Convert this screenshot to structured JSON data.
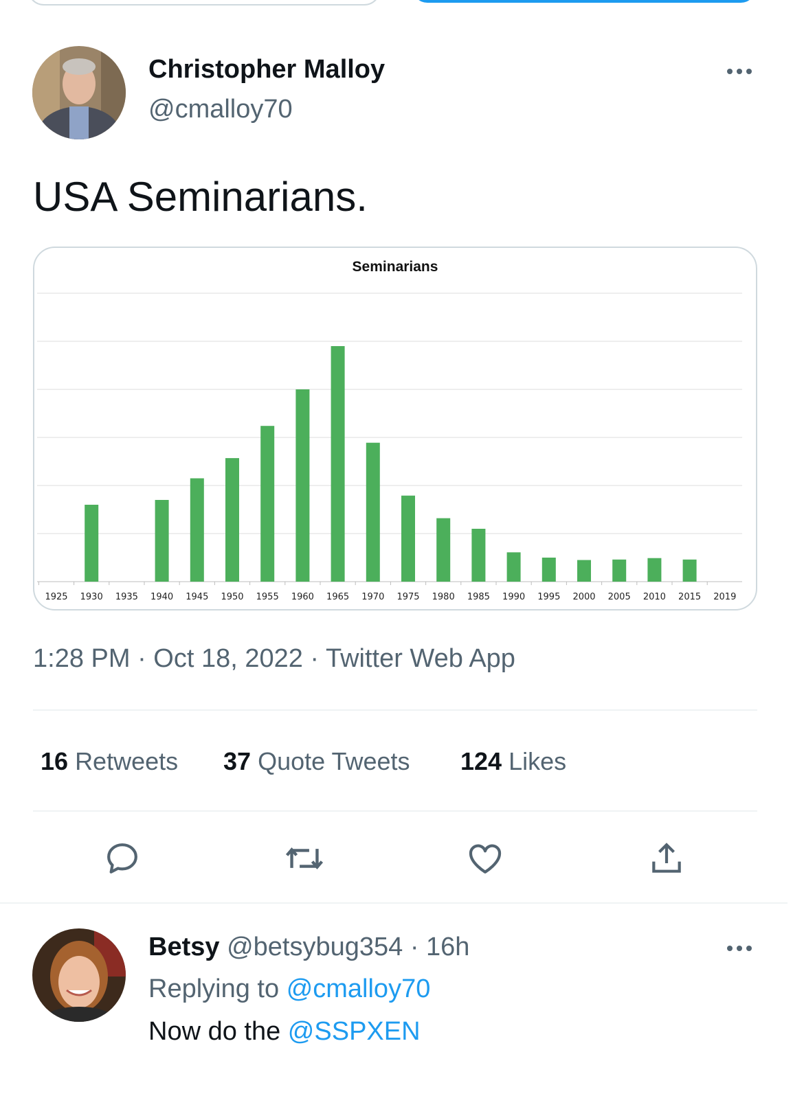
{
  "tweet": {
    "author_name": "Christopher Malloy",
    "author_handle": "@cmalloy70",
    "text": "USA Seminarians.",
    "timestamp": "1:28 PM · Oct 18, 2022 · Twitter Web App",
    "stats": {
      "retweets_count": "16",
      "retweets_label": "Retweets",
      "quotes_count": "37",
      "quotes_label": "Quote Tweets",
      "likes_count": "124",
      "likes_label": "Likes"
    },
    "actions": [
      "reply-icon",
      "retweet-icon",
      "like-icon",
      "share-icon"
    ]
  },
  "chart_data": {
    "type": "bar",
    "title": "Seminarians",
    "categories": [
      "1925",
      "1930",
      "1935",
      "1940",
      "1945",
      "1950",
      "1955",
      "1960",
      "1965",
      "1970",
      "1975",
      "1980",
      "1985",
      "1990",
      "1995",
      "2000",
      "2005",
      "2010",
      "2015",
      "2019"
    ],
    "values": [
      0,
      16,
      0,
      17,
      21.5,
      25.7,
      32.4,
      40,
      49,
      28.9,
      17.9,
      13.2,
      11,
      6.1,
      5,
      4.5,
      4.6,
      4.9,
      4.6,
      0
    ],
    "ylim": [
      0,
      60
    ],
    "gridlines": 6,
    "bar_color": "#4caf5b",
    "grid": true,
    "ylabel": "",
    "xlabel": ""
  },
  "reply": {
    "name": "Betsy",
    "handle": "@betsybug354",
    "time": "· 16h",
    "replying_prefix": "Replying to",
    "replying_handle": "@cmalloy70",
    "text_prefix": "Now do the",
    "text_mention": "@SSPXEN"
  },
  "colors": {
    "link": "#1d9bf0",
    "secondary": "#536471",
    "primary": "#0f1419"
  }
}
